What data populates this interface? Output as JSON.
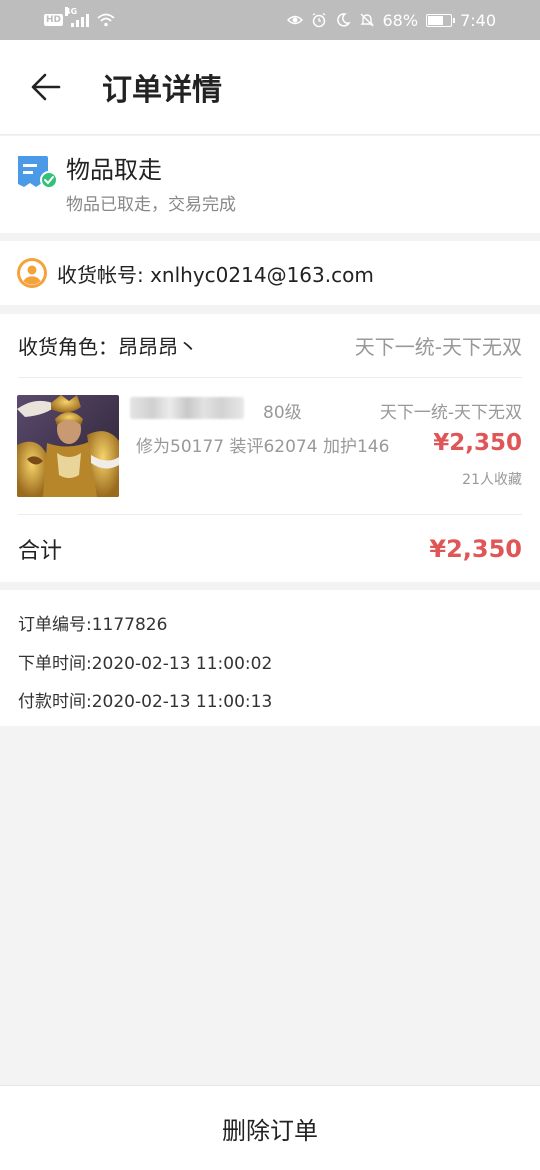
{
  "status_bar": {
    "hd": "HD",
    "net": "4G",
    "battery": "68%",
    "time": "7:40"
  },
  "header": {
    "title": "订单详情"
  },
  "order_status": {
    "title": "物品取走",
    "subtitle": "物品已取走，交易完成"
  },
  "account": {
    "text": "收货帐号: xnlhyc0214@163.com"
  },
  "role": {
    "label": "收货角色：昂昂昂丶",
    "server": "天下一统-天下无双"
  },
  "item": {
    "level": "80级",
    "server": "天下一统-天下无双",
    "stats": "修为50177 装评62074 加护146",
    "price": "¥2,350",
    "favorites": "21人收藏"
  },
  "total": {
    "label": "合计",
    "price": "¥2,350"
  },
  "order_info": {
    "order_number": "订单编号:1177826",
    "order_time": "下单时间:2020-02-13 11:00:02",
    "pay_time": "付款时间:2020-02-13 11:00:13"
  },
  "bottom": {
    "delete_label": "删除订单"
  },
  "colors": {
    "price": "#e05656",
    "status_bar": "#bdbdbd",
    "background": "#f3f3f3"
  }
}
